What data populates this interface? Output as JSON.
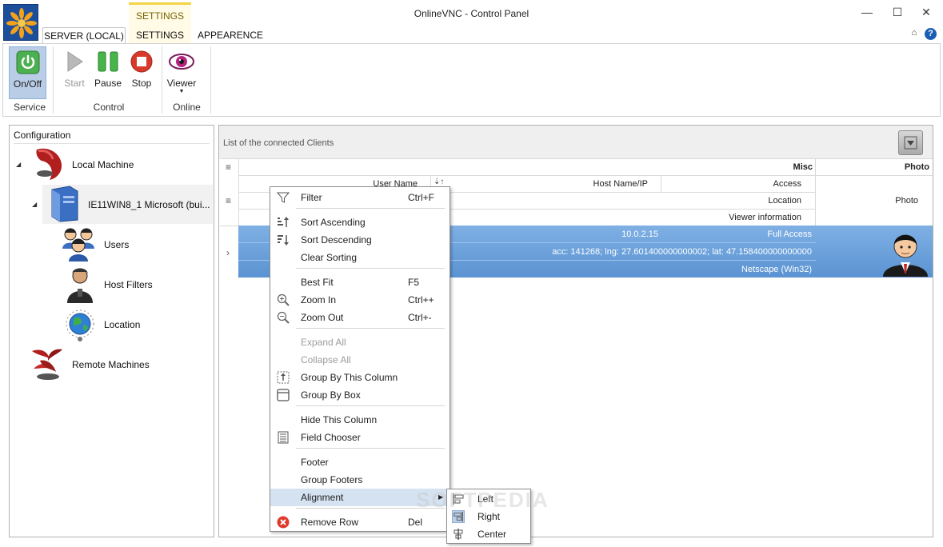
{
  "window": {
    "title": "OnlineVNC - Control Panel",
    "minimize": "—",
    "maximize": "☐",
    "close": "✕"
  },
  "ribbon": {
    "context_header": "SETTINGS",
    "tabs": [
      {
        "label": "SERVER (LOCAL)",
        "active": true
      },
      {
        "label": "SETTINGS",
        "active": false
      },
      {
        "label": "APPEARENCE",
        "active": false
      }
    ],
    "help": "?",
    "groups": [
      {
        "label": "Service",
        "buttons": [
          {
            "label": "On/Off",
            "icon": "power-icon",
            "pressed": true
          }
        ]
      },
      {
        "label": "Control",
        "buttons": [
          {
            "label": "Start",
            "icon": "play-icon",
            "enabled": false
          },
          {
            "label": "Pause",
            "icon": "pause-icon",
            "enabled": true
          },
          {
            "label": "Stop",
            "icon": "stop-icon",
            "enabled": true
          }
        ]
      },
      {
        "label": "Online",
        "buttons": [
          {
            "label": "Viewer",
            "icon": "eye-icon",
            "dropdown": true
          }
        ]
      }
    ]
  },
  "config": {
    "title": "Configuration",
    "tree": [
      {
        "label": "Local Machine",
        "icon": "local-machine-icon"
      },
      {
        "label": "IE11WIN8_1 Microsoft  (bui...",
        "icon": "computer-icon"
      },
      {
        "label": "Users",
        "icon": "users-icon"
      },
      {
        "label": "Host Filters",
        "icon": "host-filter-icon"
      },
      {
        "label": "Location",
        "icon": "globe-icon"
      },
      {
        "label": "Remote Machines",
        "icon": "remote-machines-icon"
      }
    ]
  },
  "clients": {
    "title": "List of the connected Clients",
    "headers": {
      "misc": "Misc",
      "photo": "Photo",
      "user_name": "User Name",
      "host_name": "Host Name/IP",
      "access": "Access",
      "location": "Location",
      "viewer_info": "Viewer information",
      "photo_cell": "Photo"
    },
    "row": {
      "host": "10.0.2.15",
      "access": "Full Access",
      "location": "acc: 141268; lng: 27.601400000000002; lat: 47.158400000000000",
      "viewer": "Netscape (Win32)"
    }
  },
  "context_menu": {
    "items": [
      {
        "label": "Filter",
        "shortcut": "Ctrl+F",
        "icon": "filter-icon"
      },
      {
        "label": "Sort Ascending",
        "shortcut": "",
        "icon": "sort-ascending-icon"
      },
      {
        "label": "Sort Descending",
        "shortcut": "",
        "icon": "sort-descending-icon"
      },
      {
        "label": "Clear Sorting",
        "shortcut": "",
        "icon": ""
      },
      {
        "label": "Best Fit",
        "shortcut": "F5",
        "icon": ""
      },
      {
        "label": "Zoom In",
        "shortcut": "Ctrl++",
        "icon": "zoom-in-icon"
      },
      {
        "label": "Zoom Out",
        "shortcut": "Ctrl+-",
        "icon": "zoom-out-icon"
      },
      {
        "label": "Expand All",
        "shortcut": "",
        "icon": "",
        "disabled": true
      },
      {
        "label": "Collapse All",
        "shortcut": "",
        "icon": "",
        "disabled": true
      },
      {
        "label": "Group By This Column",
        "shortcut": "",
        "icon": "group-column-icon"
      },
      {
        "label": "Group By Box",
        "shortcut": "",
        "icon": "group-box-icon"
      },
      {
        "label": "Hide This Column",
        "shortcut": "",
        "icon": ""
      },
      {
        "label": "Field Chooser",
        "shortcut": "",
        "icon": "field-chooser-icon"
      },
      {
        "label": "Footer",
        "shortcut": "",
        "icon": ""
      },
      {
        "label": "Group Footers",
        "shortcut": "",
        "icon": ""
      },
      {
        "label": "Alignment",
        "shortcut": "",
        "icon": "",
        "submenu": true,
        "highlighted": true
      },
      {
        "label": "Remove Row",
        "shortcut": "Del",
        "icon": "remove-row-icon"
      }
    ],
    "alignment_submenu": [
      {
        "label": "Left",
        "icon": "align-left-icon"
      },
      {
        "label": "Right",
        "icon": "align-right-icon",
        "checked": true
      },
      {
        "label": "Center",
        "icon": "align-center-icon"
      }
    ]
  },
  "watermark": "SOFTPEDIA"
}
